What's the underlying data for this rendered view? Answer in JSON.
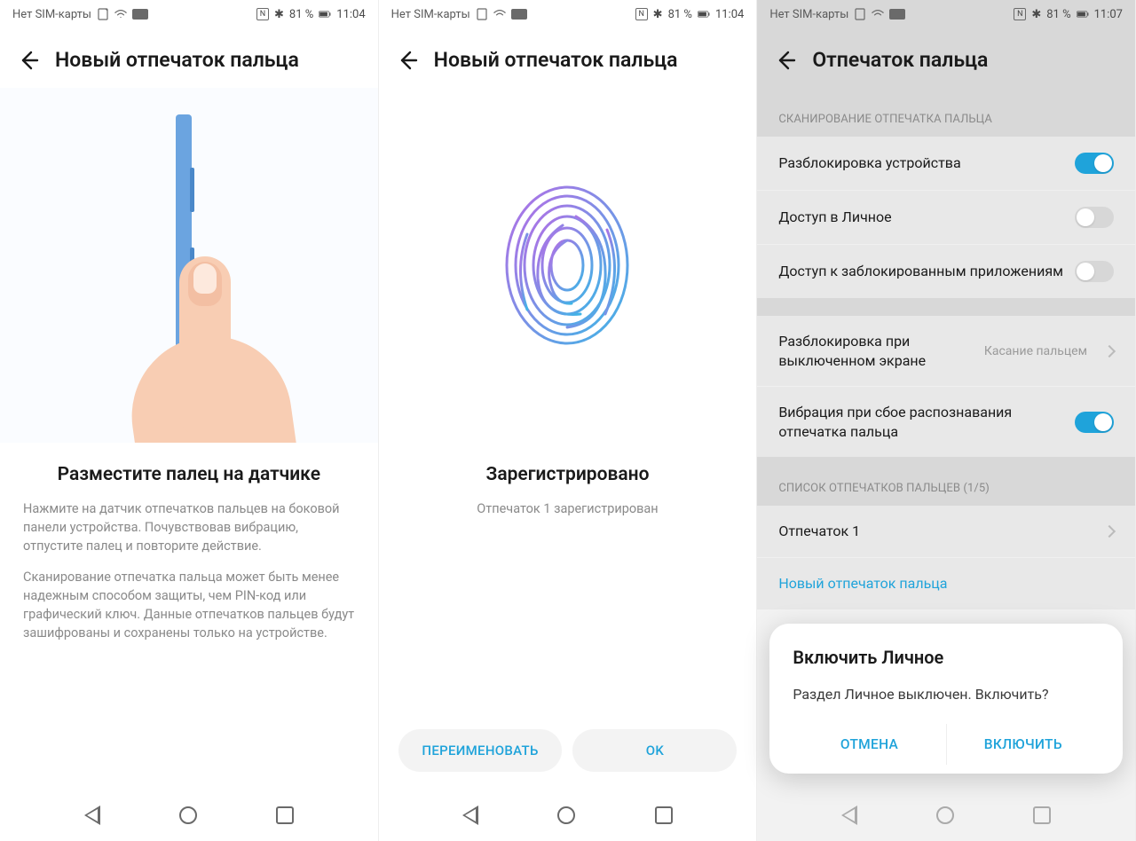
{
  "status": {
    "sim": "Нет SIM-карты",
    "nfc": "N",
    "battery_pct": "81 %",
    "bt": "✱",
    "time_a": "11:04",
    "time_c": "11:07"
  },
  "screen1": {
    "title": "Новый отпечаток пальца",
    "heading": "Разместите палец на датчике",
    "p1": "Нажмите на датчик отпечатков пальцев на боковой панели устройства. Почувствовав вибрацию, отпустите палец и повторите действие.",
    "p2": "Сканирование отпечатка пальца может быть менее надежным способом защиты, чем PIN-код или графический ключ. Данные отпечатков пальцев будут зашифрованы и сохранены только на устройстве."
  },
  "screen2": {
    "title": "Новый отпечаток пальца",
    "heading": "Зарегистрировано",
    "sub": "Отпечаток 1 зарегистрирован",
    "btn_rename": "ПЕРЕИМЕНОВАТЬ",
    "btn_ok": "OK"
  },
  "screen3": {
    "title": "Отпечаток пальца",
    "section1": "СКАНИРОВАНИЕ ОТПЕЧАТКА ПАЛЬЦА",
    "row_unlock": "Разблокировка устройства",
    "row_private": "Доступ в Личное",
    "row_applock": "Доступ к заблокированным приложениям",
    "row_offscreen": "Разблокировка при выключенном экране",
    "row_offscreen_value": "Касание пальцем",
    "row_vibrate": "Вибрация при сбое распознавания отпечатка пальца",
    "section2": "СПИСОК ОТПЕЧАТКОВ ПАЛЬЦЕВ (1/5)",
    "fp1": "Отпечаток 1",
    "new_fp": "Новый отпечаток пальца",
    "dialog_title": "Включить Личное",
    "dialog_body": "Раздел Личное выключен. Включить?",
    "dialog_cancel": "ОТМЕНА",
    "dialog_enable": "ВКЛЮЧИТЬ"
  }
}
